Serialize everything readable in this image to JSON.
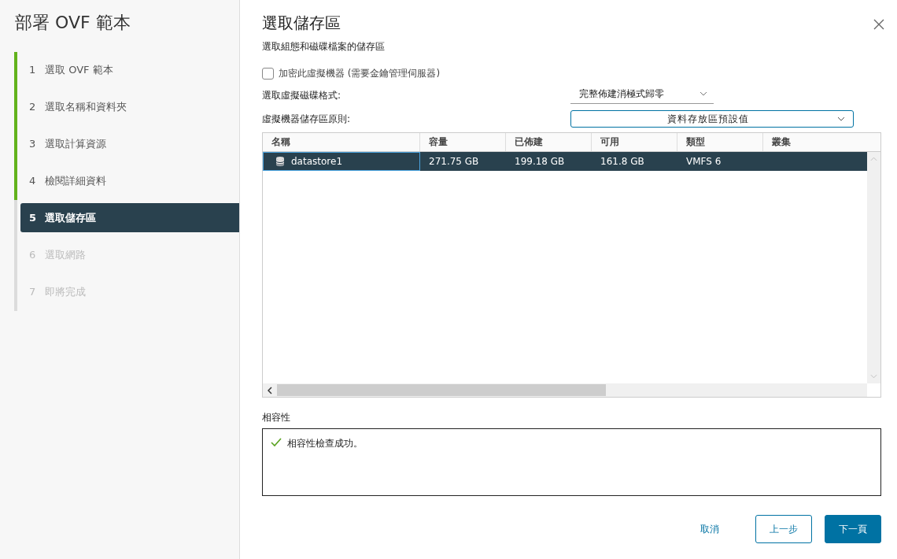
{
  "sidebar": {
    "title": "部署 OVF 範本",
    "steps": [
      {
        "number": "1",
        "label": "選取 OVF 範本",
        "completed": true,
        "selected": false,
        "disabled": false
      },
      {
        "number": "2",
        "label": "選取名稱和資料夾",
        "completed": true,
        "selected": false,
        "disabled": false
      },
      {
        "number": "3",
        "label": "選取計算資源",
        "completed": true,
        "selected": false,
        "disabled": false
      },
      {
        "number": "4",
        "label": "檢閱詳細資料",
        "completed": true,
        "selected": false,
        "disabled": false
      },
      {
        "number": "5",
        "label": "選取儲存區",
        "completed": false,
        "selected": true,
        "disabled": false
      },
      {
        "number": "6",
        "label": "選取網路",
        "completed": false,
        "selected": false,
        "disabled": true
      },
      {
        "number": "7",
        "label": "即將完成",
        "completed": false,
        "selected": false,
        "disabled": true
      }
    ]
  },
  "main": {
    "title": "選取儲存區",
    "subtitle": "選取組態和磁碟檔案的儲存區",
    "encrypt": {
      "label": "加密此虛擬機器 (需要金鑰管理伺服器)",
      "checked": false
    },
    "disk_format": {
      "label": "選取虛擬磁碟格式:",
      "value": "完整佈建消極式歸零"
    },
    "storage_policy": {
      "label": "虛擬機器儲存區原則:",
      "value": "資料存放區預設值"
    },
    "table": {
      "columns": [
        "名稱",
        "容量",
        "已佈建",
        "可用",
        "類型",
        "叢集"
      ],
      "rows": [
        {
          "selected": true,
          "cells": [
            "datastore1",
            "271.75 GB",
            "199.18 GB",
            "161.8 GB",
            "VMFS 6",
            ""
          ]
        }
      ]
    },
    "compatibility": {
      "label": "相容性",
      "message": "相容性檢查成功。"
    },
    "buttons": {
      "cancel": "取消",
      "back": "上一步",
      "next": "下一頁"
    }
  }
}
